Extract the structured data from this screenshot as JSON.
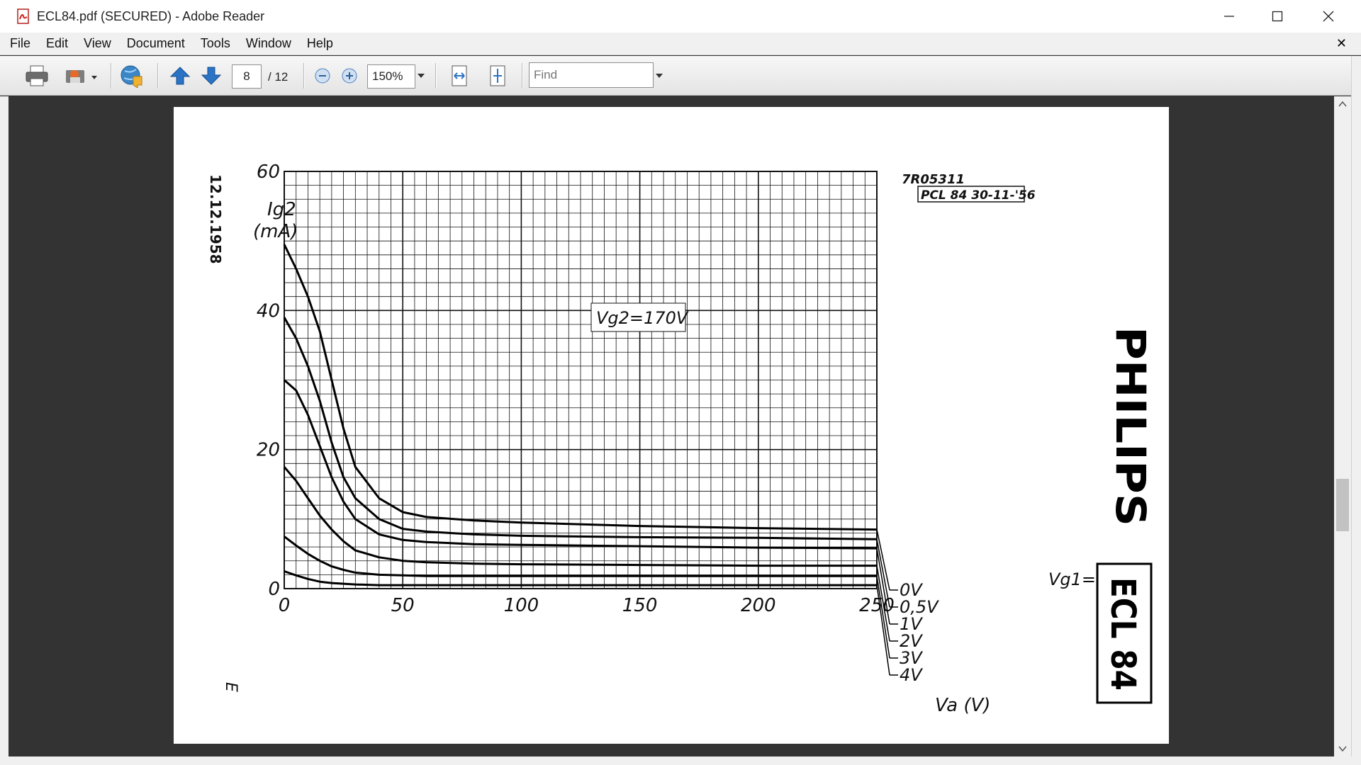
{
  "window": {
    "title": "ECL84.pdf (SECURED) - Adobe Reader"
  },
  "menu": [
    "File",
    "Edit",
    "View",
    "Document",
    "Tools",
    "Window",
    "Help"
  ],
  "toolbar": {
    "page_current": "8",
    "page_total": "/ 12",
    "zoom": "150%",
    "find_placeholder": "Find"
  },
  "document": {
    "date": "12.12.1958",
    "code": "7R05311",
    "ref": "PCL 84  30-11-'56",
    "condition": "Vg2=170V",
    "brand": "PHILIPS",
    "tube": "ECL 84",
    "corner_mark": "E",
    "vg1_label": "Vg1=",
    "x_axis_label": "Va (V)",
    "y_axis_label_top": "Ig2",
    "y_axis_label_unit": "(mA)"
  },
  "chart_data": {
    "type": "line",
    "title": "",
    "xlabel": "Va (V)",
    "ylabel": "Ig2 (mA)",
    "xlim": [
      0,
      250
    ],
    "ylim": [
      0,
      60
    ],
    "x_ticks": [
      "0",
      "50",
      "100",
      "150",
      "200",
      "250"
    ],
    "y_ticks": [
      "0",
      "20",
      "40",
      "60"
    ],
    "grid": true,
    "series": [
      {
        "name": "0V",
        "x": [
          0,
          5,
          10,
          15,
          20,
          25,
          30,
          40,
          50,
          60,
          80,
          100,
          150,
          200,
          250
        ],
        "y": [
          49.5,
          46,
          42,
          37,
          30,
          23,
          17.5,
          13,
          11,
          10.3,
          9.8,
          9.5,
          9,
          8.7,
          8.5
        ]
      },
      {
        "name": "0,5V",
        "x": [
          0,
          5,
          10,
          15,
          20,
          25,
          30,
          40,
          50,
          60,
          80,
          100,
          150,
          200,
          250
        ],
        "y": [
          39,
          36,
          32,
          27,
          21,
          16,
          13,
          10,
          8.6,
          8.2,
          7.8,
          7.6,
          7.4,
          7.3,
          7.1
        ]
      },
      {
        "name": "1V",
        "x": [
          0,
          5,
          10,
          15,
          20,
          25,
          30,
          40,
          50,
          60,
          80,
          100,
          150,
          200,
          250
        ],
        "y": [
          30,
          28.5,
          25,
          20.5,
          16,
          12.5,
          10,
          7.8,
          7,
          6.7,
          6.4,
          6.3,
          6.1,
          5.9,
          5.8
        ]
      },
      {
        "name": "2V",
        "x": [
          0,
          5,
          10,
          15,
          20,
          25,
          30,
          40,
          50,
          60,
          80,
          100,
          150,
          200,
          250
        ],
        "y": [
          17.5,
          15.5,
          13,
          10.5,
          8.5,
          6.8,
          5.5,
          4.5,
          4,
          3.8,
          3.6,
          3.5,
          3.4,
          3.3,
          3.3
        ]
      },
      {
        "name": "3V",
        "x": [
          0,
          5,
          10,
          15,
          20,
          25,
          30,
          40,
          50,
          60,
          80,
          100,
          150,
          200,
          250
        ],
        "y": [
          7.5,
          6.2,
          5,
          4,
          3.2,
          2.7,
          2.3,
          2,
          1.9,
          1.8,
          1.8,
          1.8,
          1.8,
          1.8,
          1.8
        ]
      },
      {
        "name": "4V",
        "x": [
          0,
          5,
          10,
          15,
          20,
          25,
          30,
          40,
          50,
          60,
          80,
          100,
          150,
          200,
          250
        ],
        "y": [
          2.5,
          1.9,
          1.4,
          1,
          0.8,
          0.7,
          0.6,
          0.5,
          0.5,
          0.5,
          0.5,
          0.5,
          0.5,
          0.5,
          0.5
        ]
      }
    ]
  }
}
